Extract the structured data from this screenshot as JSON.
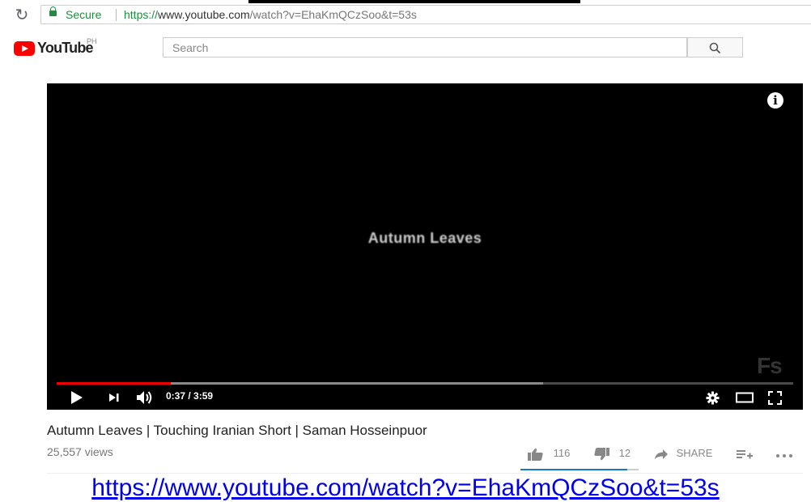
{
  "browser": {
    "secure_label": "Secure",
    "url_scheme": "https://",
    "url_host": "www.youtube.com",
    "url_rest": "/watch?v=EhaKmQCzSoo&t=53s"
  },
  "header": {
    "logo_text": "YouTube",
    "region": "PH",
    "search_placeholder": "Search"
  },
  "player": {
    "overlay_title": "Autumn Leaves",
    "watermark": "Fs",
    "time": "0:37 / 3:59",
    "progress_played": 0.155,
    "progress_buffered": 0.66
  },
  "video": {
    "title": "Autumn Leaves | Touching Iranian Short | Saman Hosseinpuor",
    "views": "25,557 views",
    "likes": "116",
    "dislikes": "12",
    "share_label": "SHARE",
    "like_ratio": 0.906
  },
  "link_text": "https://www.youtube.com/watch?v=EhaKmQCzSoo&t=53s",
  "colors": {
    "accent": "#ff0000",
    "secure": "#1e8e3e",
    "link": "#0000ee",
    "like_bar": "#167ac6"
  }
}
